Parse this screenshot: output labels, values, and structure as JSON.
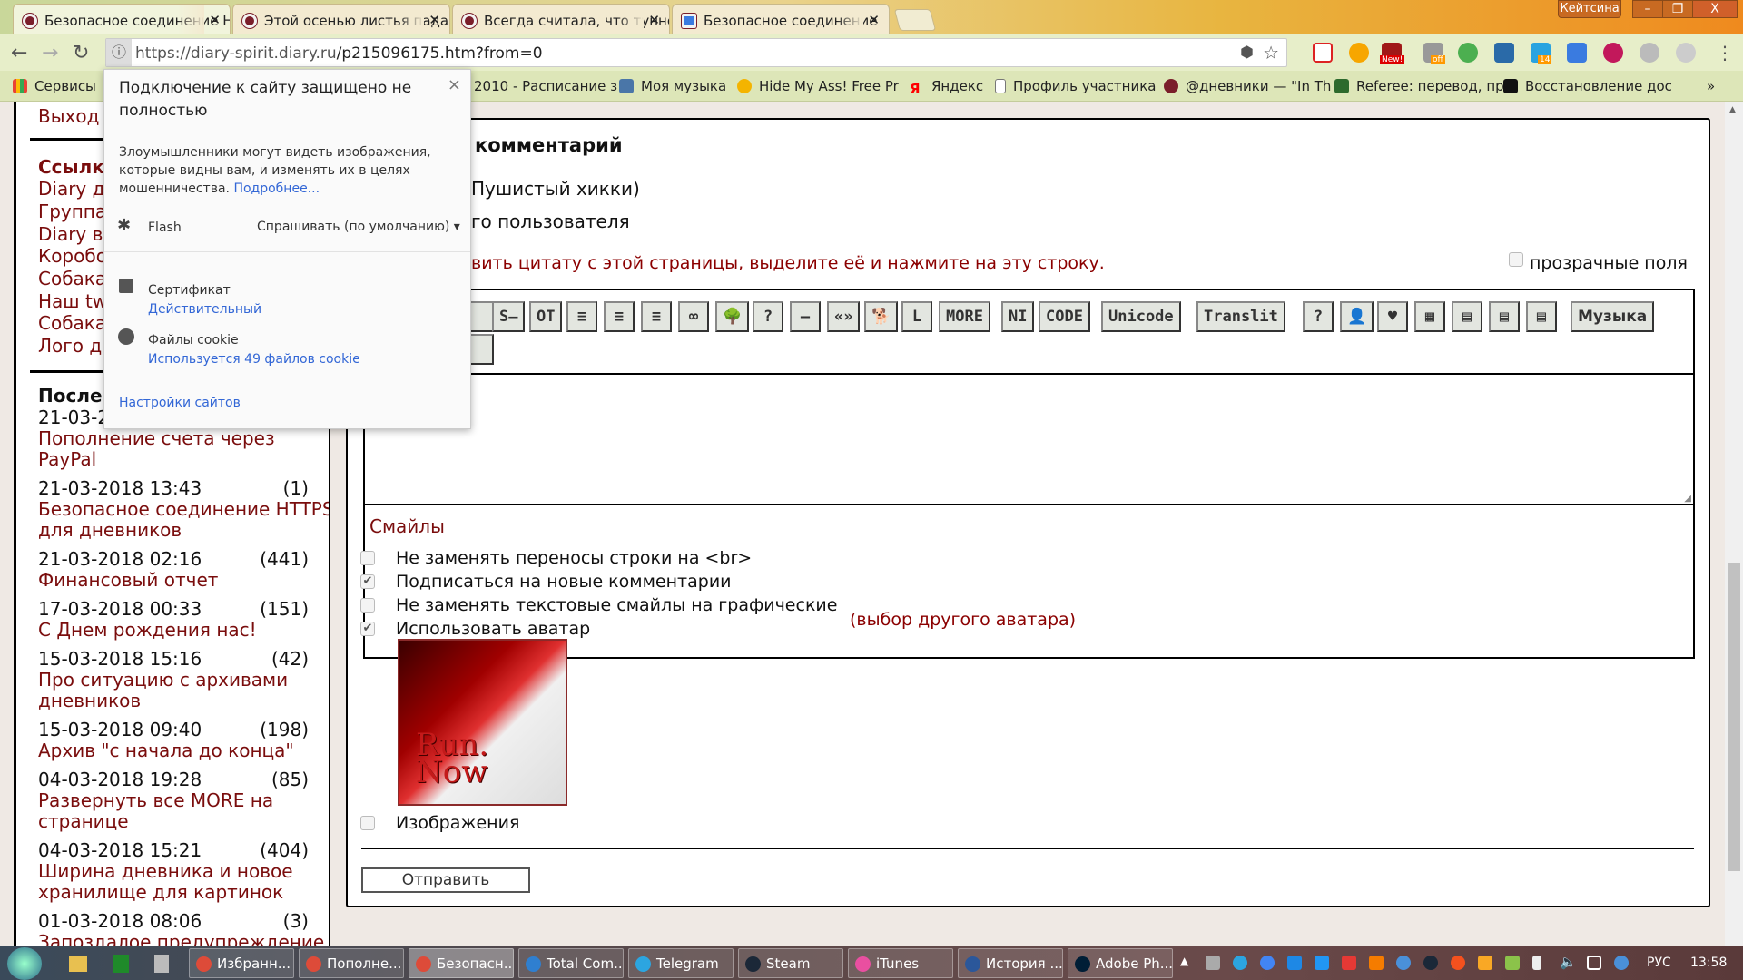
{
  "browser": {
    "tabs": [
      {
        "title": "Безопасное соединение HTTPS",
        "active": true
      },
      {
        "title": "Этой осенью листья падают",
        "active": false
      },
      {
        "title": "Всегда считала, что туннель",
        "active": false
      },
      {
        "title": "Безопасное соединение",
        "active": false
      }
    ],
    "user_label": "Кейтсина",
    "window_controls": {
      "minimize": "–",
      "restore": "❐",
      "close": "X"
    },
    "url_host": "https://diary-spirit.diary.ru",
    "url_path": "/p215096175.htm?from=0",
    "extension_badges": {
      "new": "New!",
      "off": "off",
      "count": "14"
    },
    "bookmarks": [
      {
        "label": "Сервисы",
        "icon": "apps-grid",
        "color": "#e94235"
      },
      {
        "label": "2010 - Расписание з",
        "icon": "page",
        "color": "#ffffff"
      },
      {
        "label": "Моя музыка",
        "icon": "vk",
        "color": "#4a76a8"
      },
      {
        "label": "Hide My Ass! Free Pr",
        "icon": "hma",
        "color": "#f4b400"
      },
      {
        "label": "Яндекс",
        "icon": "yandex",
        "color": "#ff0000"
      },
      {
        "label": "Профиль участника",
        "icon": "page",
        "color": "#ffffff"
      },
      {
        "label": "@дневники — \"In Th",
        "icon": "diary",
        "color": "#7a1e2a"
      },
      {
        "label": "Referee: перевод, пр",
        "icon": "referee",
        "color": "#2d6a2d"
      },
      {
        "label": "Восстановление дос",
        "icon": "keyhole",
        "color": "#111111"
      }
    ],
    "bookmarks_more": "»"
  },
  "popup": {
    "title_line1": "Подключение к сайту защищено не",
    "title_line2": "полностью",
    "close": "×",
    "body_line1": "Злоумышленники могут видеть изображения,",
    "body_line2": "которые видны вам, и изменять их в целях",
    "body_line3": "мошенничества.",
    "more_link": "Подробнее...",
    "flash_label": "Flash",
    "flash_value": "Спрашивать (по умолчанию)",
    "cert_label": "Сертификат",
    "cert_value": "Действительный",
    "cookies_label": "Файлы cookie",
    "cookies_value": "Используется 49 файлов cookie",
    "site_settings": "Настройки сайтов"
  },
  "sidebar": {
    "logout": "Выход",
    "links_title": "Ссылки",
    "links": [
      "Diary дл",
      "Группа",
      "Diary в",
      "Коробоч",
      "Собака",
      "Наш twi",
      "Собака",
      "Лого дн"
    ],
    "recent_title": "Послед",
    "recent": [
      {
        "date": "21-03-2",
        "count": "",
        "title": [
          "Пополнение счета через",
          "PayPal"
        ]
      },
      {
        "date": "21-03-2018 13:43",
        "count": "(1)",
        "title": [
          "Безопасное соединение HTTPS",
          "для дневников"
        ]
      },
      {
        "date": "21-03-2018 02:16",
        "count": "(441)",
        "title": [
          "Финансовый отчет"
        ]
      },
      {
        "date": "17-03-2018 00:33",
        "count": "(151)",
        "title": [
          "С Днем рождения нас!"
        ]
      },
      {
        "date": "15-03-2018 15:16",
        "count": "(42)",
        "title": [
          "Про ситуацию с архивами",
          "дневников"
        ]
      },
      {
        "date": "15-03-2018 09:40",
        "count": "(198)",
        "title": [
          "Архив \"с начала до конца\""
        ]
      },
      {
        "date": "04-03-2018 19:28",
        "count": "(85)",
        "title": [
          "Развернуть все MORE на",
          "странице"
        ]
      },
      {
        "date": "04-03-2018 15:21",
        "count": "(404)",
        "title": [
          "Ширина дневника и новое",
          "хранилище для картинок"
        ]
      },
      {
        "date": "01-03-2018 08:06",
        "count": "(3)",
        "title": [
          "Запоздалое предупреждение"
        ]
      }
    ]
  },
  "main": {
    "heading": "комментарий",
    "author_line": "Пушистый хикки)",
    "user_line": "го пользователя",
    "quote_hint": "вить цитату с этой страницы, выделите её и нажмите на эту строку.",
    "transparent_fields": "прозрачные поля",
    "toolbar_buttons": [
      "S̶",
      "OT",
      "≡",
      "≡",
      "≡",
      "∞",
      "🌳",
      "?",
      "—",
      "«»",
      "🐕",
      "L",
      "MORE",
      "NI",
      "CODE",
      "Unicode",
      "Translit",
      "?",
      "👤",
      "♥",
      "▦",
      "▤",
      "▤",
      "▤",
      "Музыка"
    ],
    "smiles": "Смайлы",
    "options": [
      {
        "label": "Не заменять переносы строки на <br>",
        "checked": false
      },
      {
        "label": "Подписаться на новые комментарии",
        "checked": true
      },
      {
        "label": "Не заменять текстовые смайлы на графические",
        "checked": false
      },
      {
        "label": "Использовать аватар",
        "checked": true
      }
    ],
    "avatar_link": "выбор другого аватара",
    "avatar_text": "Run. Now",
    "images_label": "Изображения",
    "send": "Отправить"
  },
  "taskbar": {
    "items": [
      {
        "label": "Избранн...",
        "color": "#dd4b39",
        "active": false
      },
      {
        "label": "Пополне...",
        "color": "#dd4b39",
        "active": false
      },
      {
        "label": "Безопасн...",
        "color": "#dd4b39",
        "active": true
      },
      {
        "label": "Total Com...",
        "color": "#2f7fd0",
        "active": false
      },
      {
        "label": "Telegram",
        "color": "#2ca5e0",
        "active": false
      },
      {
        "label": "Steam",
        "color": "#1b2838",
        "active": false
      },
      {
        "label": "iTunes",
        "color": "#e94fa0",
        "active": false
      },
      {
        "label": "История ...",
        "color": "#2b579a",
        "active": false
      },
      {
        "label": "Adobe Ph...",
        "color": "#001e36",
        "active": false
      }
    ],
    "lang": "РУС",
    "time": "13:58"
  }
}
